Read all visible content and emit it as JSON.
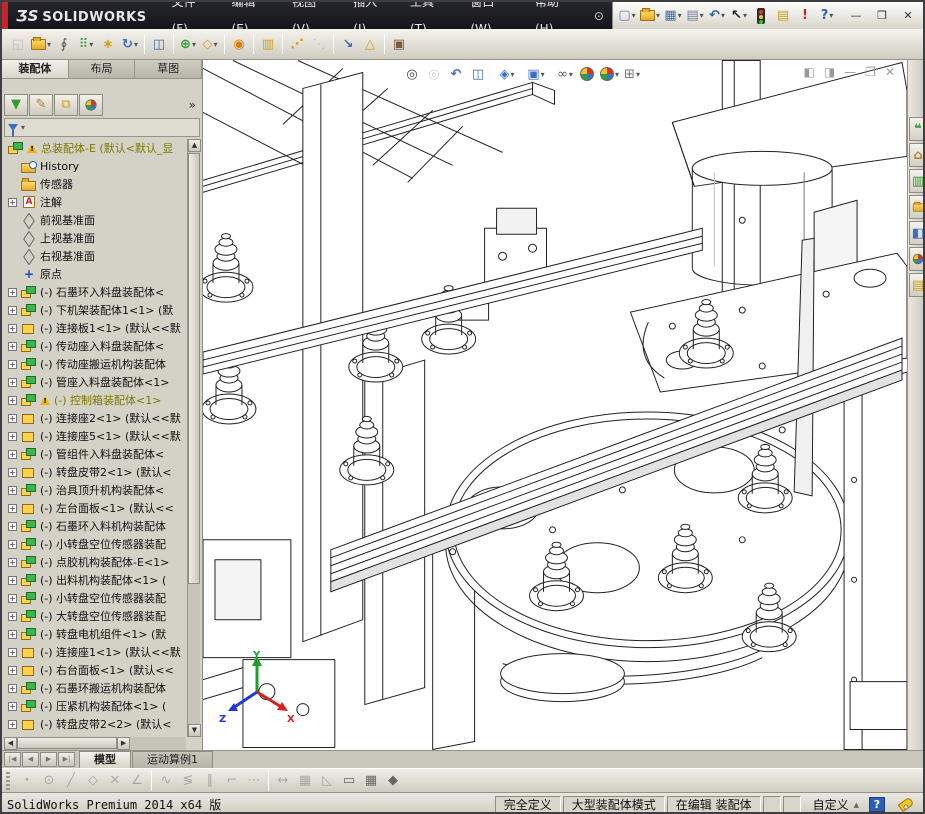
{
  "window": {
    "logo_mark": "ƷS",
    "logo_text": "SOLIDWORKS",
    "controls": [
      {
        "name": "minimize-window",
        "glyph": "—"
      },
      {
        "name": "restore-window",
        "glyph": "❐"
      },
      {
        "name": "close-window",
        "glyph": "✕"
      }
    ]
  },
  "menubar": {
    "items": [
      "文件(F)",
      "编辑(E)",
      "视图(V)",
      "插入(I)",
      "工具(T)",
      "窗口(W)",
      "帮助(H)"
    ],
    "item_names": [
      "file",
      "edit",
      "view",
      "insert",
      "tools",
      "window",
      "help"
    ]
  },
  "quick_access": {
    "buttons": [
      {
        "name": "new-document",
        "dropdown": true
      },
      {
        "name": "open-file",
        "dropdown": true
      },
      {
        "name": "save",
        "dropdown": true
      },
      {
        "name": "print",
        "dropdown": true
      },
      {
        "name": "undo",
        "dropdown": true
      },
      {
        "name": "select-cursor",
        "dropdown": true
      },
      {
        "name": "rebuild-traffic-light"
      },
      {
        "name": "file-properties"
      },
      {
        "name": "error-flag"
      },
      {
        "name": "help-question",
        "dropdown": true
      }
    ]
  },
  "assembly_toolbar": {
    "buttons": [
      {
        "name": "insert-component",
        "disabled": true
      },
      {
        "name": "open-document",
        "dropdown": true
      },
      {
        "name": "mate"
      },
      {
        "name": "linear-component-pattern",
        "dropdown": true
      },
      {
        "name": "smart-fasteners"
      },
      {
        "name": "rotate-component",
        "dropdown": true
      },
      {
        "sep": true
      },
      {
        "name": "show-hidden-components"
      },
      {
        "sep": true
      },
      {
        "name": "assembly-features",
        "dropdown": true
      },
      {
        "name": "reference-geometry",
        "dropdown": true
      },
      {
        "sep": true
      },
      {
        "name": "new-motion-study"
      },
      {
        "sep": true
      },
      {
        "name": "bill-of-materials"
      },
      {
        "sep": true
      },
      {
        "name": "exploded-view"
      },
      {
        "name": "explode-line-sketch",
        "disabled": true
      },
      {
        "sep": true
      },
      {
        "name": "instant3d"
      },
      {
        "name": "interference-detection"
      },
      {
        "sep": true
      },
      {
        "name": "take-snapshot"
      }
    ]
  },
  "left_panel": {
    "tabs": [
      {
        "label": "装配体",
        "active": true,
        "name": "tab-assembly"
      },
      {
        "label": "布局",
        "active": false,
        "name": "tab-layout"
      },
      {
        "label": "草图",
        "active": false,
        "name": "tab-sketch"
      }
    ],
    "fm_toolbar": [
      {
        "name": "featuremanager-tree"
      },
      {
        "name": "propertymanager"
      },
      {
        "name": "configurationmanager"
      },
      {
        "name": "displaymanager"
      }
    ],
    "fm_expand": "»",
    "tree": {
      "root": {
        "text": "总装配体-E (默认<默认_显",
        "warning": true
      },
      "items": [
        {
          "icon": "history-folder",
          "text": "History"
        },
        {
          "icon": "sensors-folder",
          "text": "传感器"
        },
        {
          "icon": "annotations",
          "text": "注解",
          "expand": true
        },
        {
          "icon": "plane",
          "text": "前视基准面"
        },
        {
          "icon": "plane",
          "text": "上视基准面"
        },
        {
          "icon": "plane",
          "text": "右视基准面"
        },
        {
          "icon": "origin",
          "text": "原点"
        },
        {
          "icon": "assembly",
          "text": "(-) 石墨环入料盘装配体<",
          "expand": true
        },
        {
          "icon": "assembly",
          "text": "(-) 下机架装配体1<1> (默",
          "expand": true
        },
        {
          "icon": "part",
          "text": "(-) 连接板1<1> (默认<<默",
          "expand": true
        },
        {
          "icon": "assembly",
          "text": "(-) 传动座入料盘装配体<",
          "expand": true
        },
        {
          "icon": "assembly",
          "text": "(-) 传动座搬运机构装配体",
          "expand": true
        },
        {
          "icon": "assembly",
          "text": "(-) 管座入料盘装配体<1>",
          "expand": true
        },
        {
          "icon": "assembly",
          "text": "(-) 控制箱装配体<1>",
          "expand": true,
          "warning": true,
          "highlight": true
        },
        {
          "icon": "part",
          "text": "(-) 连接座2<1> (默认<<默",
          "expand": true
        },
        {
          "icon": "part",
          "text": "(-) 连接座5<1> (默认<<默",
          "expand": true
        },
        {
          "icon": "assembly",
          "text": "(-) 管组件入料盘装配体<",
          "expand": true
        },
        {
          "icon": "part",
          "text": "(-) 转盘皮带2<1> (默认<",
          "expand": true
        },
        {
          "icon": "assembly",
          "text": "(-) 治具顶升机构装配体<",
          "expand": true
        },
        {
          "icon": "part",
          "text": "(-) 左台面板<1> (默认<<",
          "expand": true
        },
        {
          "icon": "assembly",
          "text": "(-) 石墨环入料机构装配体",
          "expand": true
        },
        {
          "icon": "assembly",
          "text": "(-) 小转盘空位传感器装配",
          "expand": true
        },
        {
          "icon": "assembly",
          "text": "(-) 点胶机构装配体-E<1>",
          "expand": true
        },
        {
          "icon": "assembly",
          "text": "(-) 出料机构装配体<1> (",
          "expand": true
        },
        {
          "icon": "assembly",
          "text": "(-) 小转盘空位传感器装配",
          "expand": true
        },
        {
          "icon": "assembly",
          "text": "(-) 大转盘空位传感器装配",
          "expand": true
        },
        {
          "icon": "assembly",
          "text": "(-) 转盘电机组件<1> (默",
          "expand": true
        },
        {
          "icon": "part",
          "text": "(-) 连接座1<1> (默认<<默",
          "expand": true
        },
        {
          "icon": "part",
          "text": "(-) 右台面板<1> (默认<<",
          "expand": true
        },
        {
          "icon": "assembly",
          "text": "(-) 石墨环搬运机构装配体",
          "expand": true
        },
        {
          "icon": "assembly",
          "text": "(-) 压紧机构装配体<1> (",
          "expand": true
        },
        {
          "icon": "part",
          "text": "(-) 转盘皮带2<2> (默认<",
          "expand": true
        }
      ]
    }
  },
  "viewport": {
    "headsup": [
      {
        "name": "zoom-to-fit"
      },
      {
        "name": "zoom-to-area",
        "disabled": true
      },
      {
        "name": "previous-view"
      },
      {
        "name": "section-view"
      },
      {
        "sep": true
      },
      {
        "name": "view-orientation",
        "dropdown": true
      },
      {
        "sep": true
      },
      {
        "name": "display-style",
        "dropdown": true
      },
      {
        "sep": true
      },
      {
        "name": "hide-show-items",
        "dropdown": true
      },
      {
        "name": "apply-scene"
      },
      {
        "name": "view-settings",
        "dropdown": true
      },
      {
        "name": "edit-appearance",
        "dropdown": true
      }
    ],
    "mdi_controls": [
      {
        "name": "split-view-left",
        "glyph": "◧"
      },
      {
        "name": "split-view-right",
        "glyph": "◨"
      },
      {
        "name": "minimize-document",
        "glyph": "—"
      },
      {
        "name": "restore-document",
        "glyph": "❐"
      },
      {
        "name": "close-document",
        "glyph": "✕"
      }
    ],
    "triad": {
      "x": "X",
      "y": "Y",
      "z": "Z"
    }
  },
  "task_pane": {
    "buttons": [
      {
        "name": "solidworks-resources"
      },
      {
        "name": "home"
      },
      {
        "name": "design-library"
      },
      {
        "name": "file-explorer"
      },
      {
        "name": "view-palette"
      },
      {
        "name": "appearances-scenes"
      },
      {
        "name": "custom-properties"
      }
    ]
  },
  "model_tab_bar": {
    "nav": [
      {
        "name": "first-view",
        "glyph": "|◀"
      },
      {
        "name": "prev-view",
        "glyph": "◀"
      },
      {
        "name": "next-view",
        "glyph": "▶"
      },
      {
        "name": "last-view",
        "glyph": "▶|"
      }
    ],
    "tabs": [
      {
        "label": "模型",
        "active": true,
        "name": "tab-model"
      },
      {
        "label": "运动算例1",
        "active": false,
        "name": "tab-motion-study-1"
      }
    ]
  },
  "sketch_toolbar": {
    "buttons": [
      {
        "name": "sketch-point",
        "disabled": true
      },
      {
        "name": "circle",
        "disabled": true
      },
      {
        "name": "line",
        "disabled": true
      },
      {
        "name": "polygon",
        "disabled": true
      },
      {
        "name": "trim-entities",
        "disabled": true
      },
      {
        "name": "sketch-chamfer",
        "disabled": true
      },
      {
        "sep": true
      },
      {
        "name": "spline",
        "disabled": true
      },
      {
        "name": "mirror-entities",
        "disabled": true
      },
      {
        "name": "offset-entities",
        "disabled": true
      },
      {
        "name": "corner-rectangle",
        "disabled": true
      },
      {
        "name": "point-chain",
        "disabled": true
      },
      {
        "sep": true
      },
      {
        "name": "smart-dimension",
        "disabled": true
      },
      {
        "name": "grid-system",
        "disabled": true
      },
      {
        "name": "angle-dimension",
        "disabled": true
      },
      {
        "name": "section-face",
        "blue": true
      },
      {
        "name": "table",
        "blue": true
      },
      {
        "name": "plane",
        "blue": true
      }
    ]
  },
  "status_bar": {
    "left_text": "SolidWorks Premium 2014 x64 版",
    "cells": [
      "完全定义",
      "大型装配体模式",
      "在编辑 装配体"
    ],
    "cell_names": [
      "status-fully-defined",
      "status-large-assembly-mode",
      "status-editing-assembly"
    ],
    "custom_label": "自定义",
    "help_glyph": "?"
  },
  "colors": {
    "accent_red": "#c5242b",
    "title_bg": "#15151a",
    "warning_text": "#7d7a00",
    "selection": "#3a6ea5"
  }
}
